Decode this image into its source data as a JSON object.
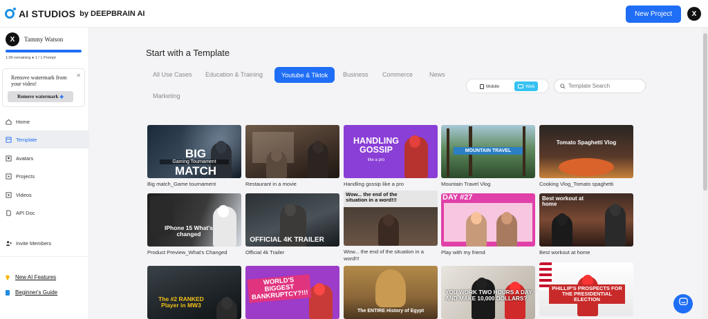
{
  "header": {
    "logo_text": "AI STUDIOS",
    "logo_sub": "by DEEPBRAIN AI",
    "new_project_label": "New Project",
    "avatar_initial": "X"
  },
  "sidebar": {
    "user": {
      "initial": "X",
      "name": "Tammy Watson",
      "quota": "1:00 remaining ● 1 / 1 Prompt"
    },
    "watermark": {
      "text": "Remove watermark from your video!",
      "button": "Remove watermark",
      "close": "✕"
    },
    "nav": [
      {
        "label": "Home",
        "icon": "home-icon"
      },
      {
        "label": "Template",
        "icon": "template-icon",
        "active": true
      },
      {
        "label": "Avatars",
        "icon": "avatar-icon"
      },
      {
        "label": "Projects",
        "icon": "projects-icon"
      },
      {
        "label": "Videos",
        "icon": "video-icon"
      },
      {
        "label": "API Doc",
        "icon": "doc-icon"
      }
    ],
    "invite": "Invite Members",
    "links": [
      {
        "label": "New AI Features",
        "icon": "bulb-icon",
        "color": "#f4b400"
      },
      {
        "label": "Beginner's Guide",
        "icon": "book-icon",
        "color": "#1f8ce3"
      }
    ]
  },
  "main": {
    "title": "Start with a Template",
    "tabs": [
      "All Use Cases",
      "Education & Training",
      "Youtube & Tiktok",
      "Business",
      "Commerce",
      "News",
      "Marketing"
    ],
    "active_tab": "Youtube & Tiktok",
    "view_toggle": {
      "mobile": "Mobile",
      "web": "Web",
      "active": "Web"
    },
    "search_placeholder": "Template Search"
  },
  "templates": [
    {
      "caption": "Big match_Game tournament",
      "overlay": "BIG MATCH",
      "sub": "Gaming Tournament"
    },
    {
      "caption": "Restaurant in a movie",
      "overlay": ""
    },
    {
      "caption": "Handling gossip like a pro",
      "overlay": "HANDLING GOSSIP",
      "sub": "like a pro"
    },
    {
      "caption": "Mountain Travel Vlog",
      "overlay": "MOUNTAIN TRAVEL"
    },
    {
      "caption": "Cooking Vlog_Tomato spaghetti",
      "overlay": "Tomato Spaghetti Vlog"
    },
    {
      "caption": "Product Preview_What's Changed",
      "overlay": "IPhone 15 What's changed"
    },
    {
      "caption": "Official 4k Trailer",
      "overlay": "OFFICIAL 4K TRAILER"
    },
    {
      "caption": "Wow... the end of the situation in a word!!!",
      "overlay": "Wow... the end of the situation in a word!!!"
    },
    {
      "caption": "Play with my friend",
      "overlay": "DAY #27"
    },
    {
      "caption": "Best workout at home",
      "overlay": "Best workout at home"
    },
    {
      "caption": "",
      "overlay": "The #2 RANKED Player in MW3"
    },
    {
      "caption": "",
      "overlay": "WORLD'S BIGGEST BANKRUPTCY?!!!"
    },
    {
      "caption": "",
      "overlay": "The ENTIRE History of Egypt"
    },
    {
      "caption": "",
      "overlay": "YOU WORK TWO HOURS A DAY AND MAKE 10,000 DOLLARS?"
    },
    {
      "caption": "",
      "overlay": "PHILLIP'S PROSPECTS FOR THE PRESIDENTIAL ELECTION"
    }
  ],
  "colors": {
    "accent": "#1f6ef5",
    "web_toggle": "#35c1f1"
  }
}
